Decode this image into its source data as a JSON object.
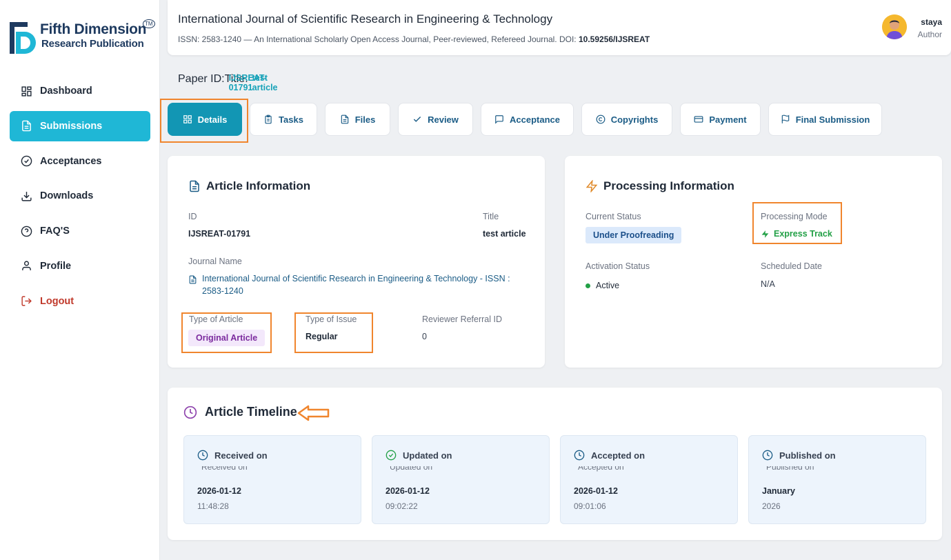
{
  "brand": {
    "line1": "Fifth Dimension",
    "line2": "Research Publication",
    "tm": "TM"
  },
  "nav": [
    {
      "label": "Dashboard",
      "icon": "dashboard-icon",
      "active": false
    },
    {
      "label": "Submissions",
      "icon": "file-icon",
      "active": true
    },
    {
      "label": "Acceptances",
      "icon": "check-circle-icon",
      "active": false
    },
    {
      "label": "Downloads",
      "icon": "download-icon",
      "active": false
    },
    {
      "label": "FAQ'S",
      "icon": "help-icon",
      "active": false
    },
    {
      "label": "Profile",
      "icon": "user-icon",
      "active": false
    },
    {
      "label": "Logout",
      "icon": "logout-icon",
      "active": false
    }
  ],
  "header": {
    "journal_title": "International Journal of Scientific Research in Engineering & Technology",
    "journal_sub_prefix": "ISSN: 2583-1240 — An International Scholarly Open Access Journal, Peer-reviewed, Refereed Journal. DOI: ",
    "doi": "10.59256/IJSREAT",
    "user_name": "staya",
    "user_role": "Author"
  },
  "paper": {
    "id_label": "Paper ID:",
    "id_value": "IJSREAT-01791",
    "title_label": "Title:",
    "title_value": "test article"
  },
  "tabs": [
    {
      "label": "Details",
      "icon": "grid-icon"
    },
    {
      "label": "Tasks",
      "icon": "clipboard-icon"
    },
    {
      "label": "Files",
      "icon": "file-icon"
    },
    {
      "label": "Review",
      "icon": "check-icon"
    },
    {
      "label": "Acceptance",
      "icon": "message-icon"
    },
    {
      "label": "Copyrights",
      "icon": "copyright-icon"
    },
    {
      "label": "Payment",
      "icon": "credit-card-icon"
    },
    {
      "label": "Final Submission",
      "icon": "flag-icon"
    }
  ],
  "article_info": {
    "title": "Article Information",
    "id_label": "ID",
    "id_value": "IJSREAT-01791",
    "title_label": "Title",
    "title_value": "test article",
    "journal_label": "Journal Name",
    "journal_line1": "International Journal of Scientific Research in Engineering & Technology - ISSN :",
    "journal_line2": "2583-1240",
    "type_article_label": "Type of Article",
    "type_article_value": "Original Article",
    "type_issue_label": "Type of Issue",
    "type_issue_value": "Regular",
    "referral_label": "Reviewer Referral ID",
    "referral_value": "0"
  },
  "processing": {
    "title": "Processing Information",
    "status_label": "Current Status",
    "status_value": "Under Proofreading",
    "mode_label": "Processing Mode",
    "mode_value": "Express Track",
    "activation_label": "Activation Status",
    "activation_value": "Active",
    "scheduled_label": "Scheduled Date",
    "scheduled_value": "N/A"
  },
  "timeline": {
    "title": "Article Timeline",
    "items": [
      {
        "label": "Received on",
        "ghost": "Received on",
        "date": "2026-01-12",
        "time": "11:48:28",
        "icon": "clock-icon",
        "color": "#1b5c86"
      },
      {
        "label": "Updated on",
        "ghost": "Updated on",
        "date": "2026-01-12",
        "time": "09:02:22",
        "icon": "check-circle-icon",
        "color": "#22a046"
      },
      {
        "label": "Accepted on",
        "ghost": "Accepted on",
        "date": "2026-01-12",
        "time": "09:01:06",
        "icon": "clock-icon",
        "color": "#1b5c86"
      },
      {
        "label": "Published on",
        "ghost": "Published on",
        "date": "January",
        "time": "2026",
        "icon": "clock-icon",
        "color": "#1b5c86"
      }
    ]
  },
  "colors": {
    "accent": "#1fb7d6",
    "tab_active": "#1296b4",
    "highlight": "#f0852d",
    "link": "#1b5c86"
  }
}
